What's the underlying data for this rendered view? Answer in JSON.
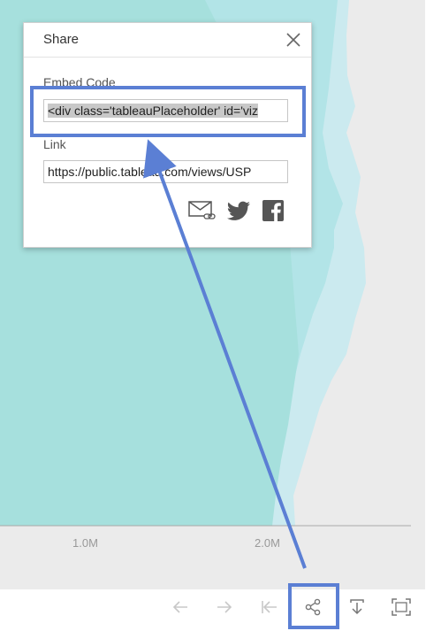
{
  "chart": {
    "ticks": [
      "1.0M",
      "2.0M"
    ],
    "colors": {
      "background": "#ebebeb",
      "light_area": "#cbeaef",
      "mid_area": "#b2e4e7",
      "main_area": "#a6e0dd",
      "axis": "#a8a8a8"
    }
  },
  "dialog": {
    "title": "Share",
    "close_icon": "close-icon",
    "embed_label": "Embed Code",
    "embed_value": "<div class='tableauPlaceholder' id='viz",
    "link_label": "Link",
    "link_value": "https://public.tableau.com/views/USP",
    "social": [
      "email-link-icon",
      "twitter-icon",
      "facebook-icon"
    ]
  },
  "toolbar": {
    "buttons": [
      "undo-icon",
      "redo-icon",
      "revert-icon",
      "share-icon",
      "download-icon",
      "fullscreen-icon"
    ]
  },
  "annotation": {
    "highlight_color": "#5b7fd4"
  }
}
